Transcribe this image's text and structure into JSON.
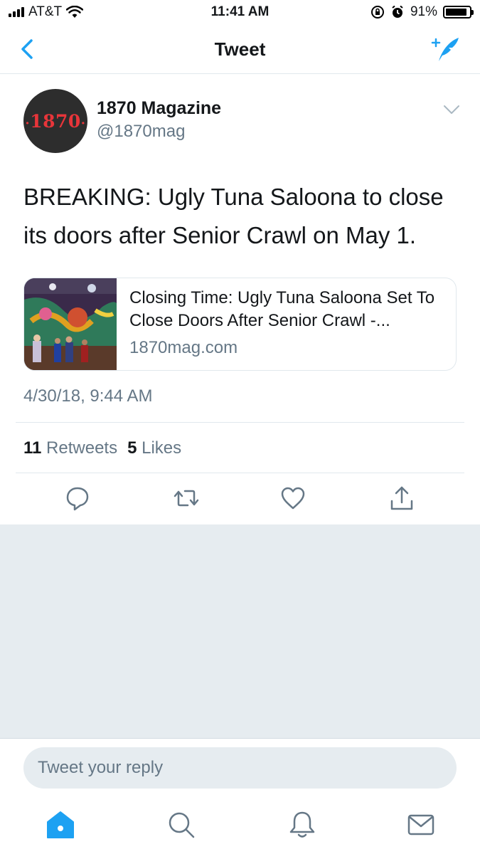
{
  "status_bar": {
    "carrier": "AT&T",
    "time": "11:41 AM",
    "battery": "91%",
    "battery_level": 0.91
  },
  "nav": {
    "title": "Tweet",
    "back_icon": "chevron-left-icon",
    "compose_icon": "compose-tweet-icon"
  },
  "tweet": {
    "avatar_text": "1870",
    "author_name": "1870 Magazine",
    "author_handle": "@1870mag",
    "text": "BREAKING: Ugly Tuna Saloona to close its doors after Senior Crawl on May 1.",
    "card": {
      "title": "Closing Time: Ugly Tuna Saloona Set To Close Doors After Senior Crawl -...",
      "domain": "1870mag.com"
    },
    "timestamp": "4/30/18, 9:44 AM",
    "retweets_count": "11",
    "retweets_label": "Retweets",
    "likes_count": "5",
    "likes_label": "Likes"
  },
  "reply": {
    "placeholder": "Tweet your reply"
  },
  "colors": {
    "accent": "#1da1f2",
    "secondary_text": "#657786",
    "gray_background": "#e6ecf0"
  },
  "tabs": [
    "home-icon",
    "search-icon",
    "notifications-icon",
    "messages-icon"
  ]
}
